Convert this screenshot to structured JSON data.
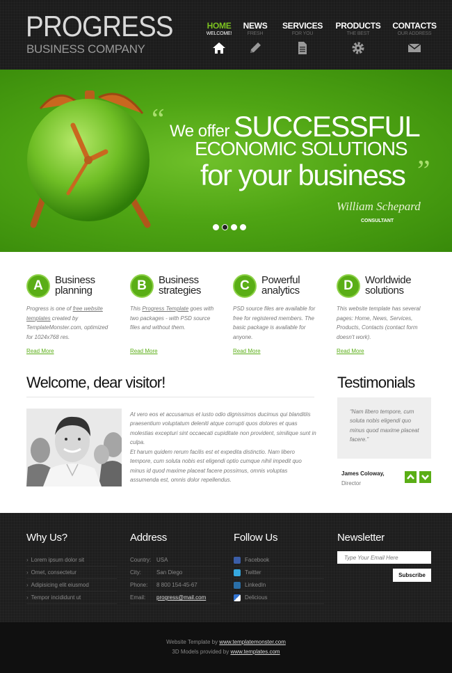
{
  "header": {
    "logo_title": "PROGRESS",
    "logo_subtitle": "BUSINESS COMPANY",
    "nav": [
      {
        "label": "HOME",
        "sub": "WELCOME!",
        "icon": "home-icon",
        "active": true
      },
      {
        "label": "NEWS",
        "sub": "FRESH",
        "icon": "pencil-icon",
        "active": false
      },
      {
        "label": "SERVICES",
        "sub": "FOR YOU",
        "icon": "document-icon",
        "active": false
      },
      {
        "label": "PRODUCTS",
        "sub": "THE BEST",
        "icon": "gear-icon",
        "active": false
      },
      {
        "label": "CONTACTS",
        "sub": "OUR ADDRESS",
        "icon": "mail-icon",
        "active": false
      }
    ]
  },
  "banner": {
    "quote_open": "“",
    "quote_close": "”",
    "line1_small": "We offer",
    "line1_big": "SUCCESSFUL",
    "line2": "ECONOMIC SOLUTIONS",
    "line3": "for your business",
    "signature": "William Schepard",
    "role": "CONSULTANT",
    "slides": 4,
    "active_slide": 2
  },
  "features": [
    {
      "letter": "A",
      "title_line1": "Business",
      "title_line2": "planning",
      "text_pre": "Progress is one of ",
      "text_link": "free website templates",
      "text_post": " created by TemplateMonster.com, optimized for 1024x768 res.",
      "more": "Read More"
    },
    {
      "letter": "B",
      "title_line1": "Business",
      "title_line2": "strategies",
      "text_pre": "This ",
      "text_link": "Progress Template",
      "text_post": " goes with two packages - with PSD source files and without them.",
      "more": "Read More"
    },
    {
      "letter": "C",
      "title_line1": "Powerful",
      "title_line2": "analytics",
      "text_pre": "PSD source files are available for free for registered members. The basic package is available for anyone.",
      "text_link": "",
      "text_post": "",
      "more": "Read More"
    },
    {
      "letter": "D",
      "title_line1": "Worldwide",
      "title_line2": "solutions",
      "text_pre": "This website template has several pages: Home, News, Services, Products, Contacts (contact form doesn't work).",
      "text_link": "",
      "text_post": "",
      "more": "Read More"
    }
  ],
  "welcome": {
    "title": "Welcome, dear visitor!",
    "paragraph1": "At vero eos et accusamus et iusto odio dignissimos ducimus qui blanditiis praesentium voluptatum deleniti atque corrupti quos dolores et quas molestias excepturi sint occaecati cupiditate non provident, similique sunt in culpa.",
    "paragraph2": "Et harum quidem rerum facilis est et expedita distinctio. Nam libero tempore, cum soluta nobis est eligendi optio cumque nihil impedit quo minus id quod maxime placeat facere possimus, omnis voluptas assumenda est, omnis dolor repellendus."
  },
  "testimonials": {
    "title": "Testimonials",
    "quote": "“Nam libero tempore, cum soluta nobis eligendi quo minus quod maxime placeat facere.”",
    "author": "James Coloway,",
    "role": "Director"
  },
  "footer": {
    "why_title": "Why Us?",
    "why_items": [
      "Lorem ipsum dolor sit",
      "Omet, consectetur",
      "Adipisicing elit eiusmod",
      "Tempor incididunt ut"
    ],
    "address_title": "Address",
    "address": [
      {
        "key": "Country:",
        "value": "USA"
      },
      {
        "key": "City:",
        "value": "San Diego"
      },
      {
        "key": "Phone:",
        "value": "8 800 154-45-67"
      },
      {
        "key": "Email:",
        "value": "progress@mail.com"
      }
    ],
    "follow_title": "Follow Us",
    "follow": [
      {
        "label": "Facebook",
        "icon": "facebook-icon",
        "color": "#3b5ea8"
      },
      {
        "label": "Twitter",
        "icon": "twitter-icon",
        "color": "#36a8df"
      },
      {
        "label": "LinkedIn",
        "icon": "linkedin-icon",
        "color": "#2a6fa8"
      },
      {
        "label": "Delicious",
        "icon": "delicious-icon",
        "color": "#3374d2"
      }
    ],
    "newsletter_title": "Newsletter",
    "newsletter_placeholder": "Type Your Email Here",
    "newsletter_button": "Subscribe"
  },
  "bottom": {
    "line1_pre": "Website Template by ",
    "line1_link": "www.templatemonster.com",
    "line2_pre": "3D Models provided by ",
    "line2_link": "www.templates.com"
  },
  "colors": {
    "accent": "#5aae16",
    "header_bg": "#1c1c1c",
    "banner_green": "#4fa514"
  }
}
